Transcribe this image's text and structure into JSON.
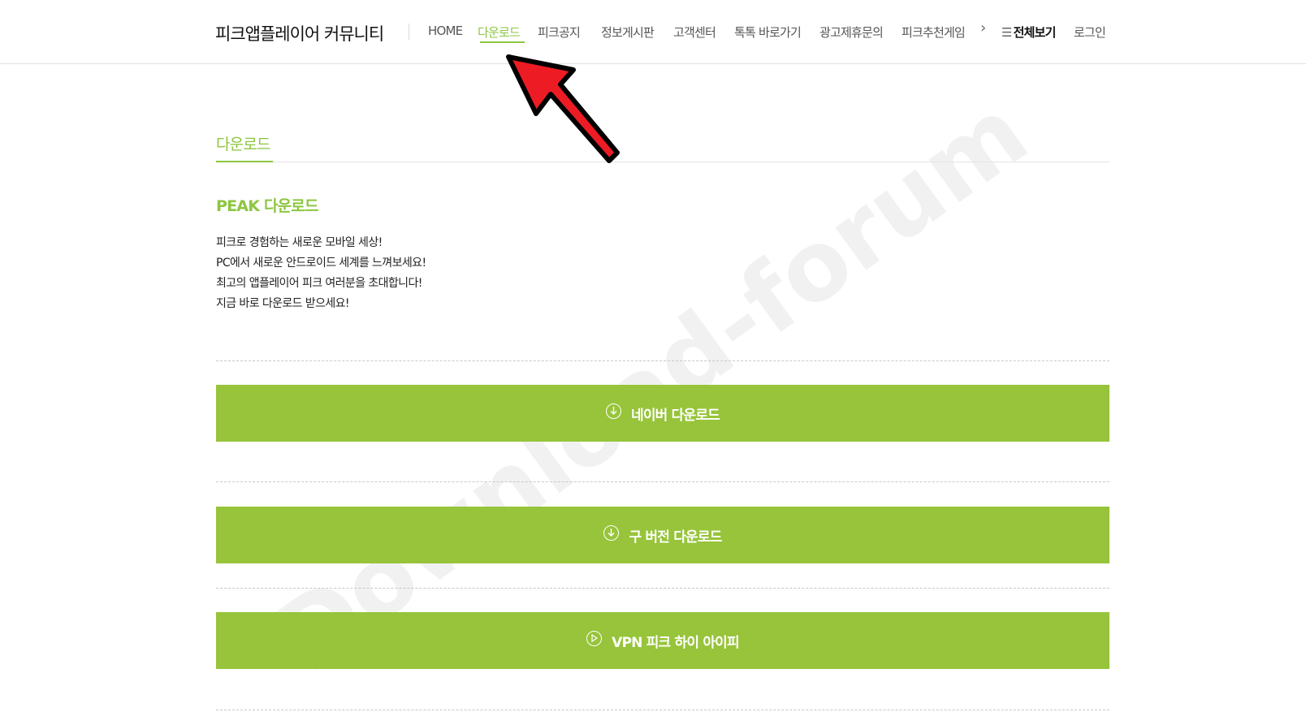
{
  "header": {
    "site_title": "피크앱플레이어 커뮤니티",
    "nav": [
      {
        "label": "HOME"
      },
      {
        "label": "다운로드",
        "active": true
      },
      {
        "label": "피크공지"
      },
      {
        "label": "정보게시판"
      },
      {
        "label": "고객센터"
      },
      {
        "label": "톡톡 바로가기"
      },
      {
        "label": "광고제휴문의"
      },
      {
        "label": "피크추천게임"
      }
    ],
    "menu_all_label": "전체보기",
    "login_label": "로그인"
  },
  "page": {
    "tab_label": "다운로드",
    "section_title": "PEAK 다운로드",
    "description": [
      "피크로 경험하는 새로운 모바일 세상!",
      "PC에서 새로운 안드로이드 세계를 느껴보세요!",
      "최고의 앱플레이어 피크 여러분을 초대합니다!",
      "지금 바로 다운로드 받으세요!"
    ]
  },
  "buttons": [
    {
      "label": "네이버 다운로드",
      "icon": "download-circle-icon"
    },
    {
      "label": "구 버전 다운로드",
      "icon": "download-circle-icon"
    },
    {
      "label": "VPN 피크 하이 아이피",
      "icon": "play-circle-icon"
    }
  ],
  "watermark": "Download-forum",
  "colors": {
    "accent": "#8cc63f",
    "button_bg": "#97c43a",
    "annotation_arrow": "#ed1c24"
  }
}
